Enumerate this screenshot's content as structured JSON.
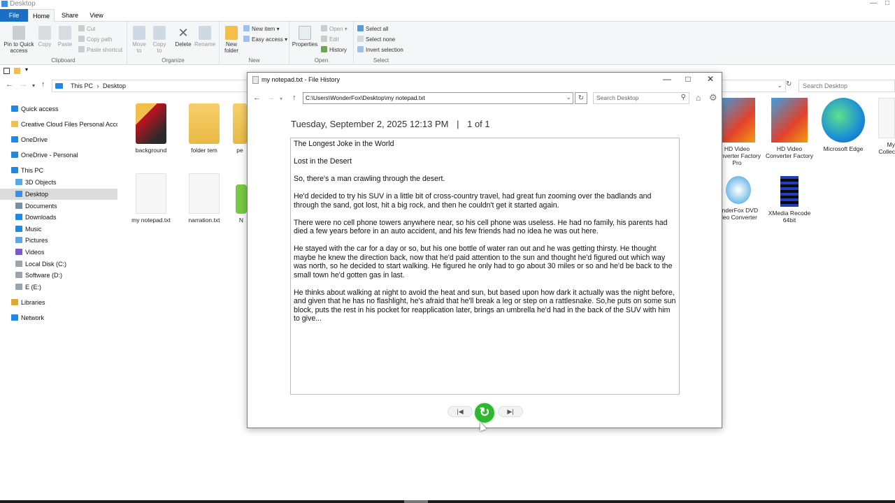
{
  "explorer": {
    "title": "Desktop",
    "tabs": [
      "File",
      "Home",
      "Share",
      "View"
    ],
    "ribbon": {
      "clipboard": {
        "label": "Clipboard",
        "pin": "Pin to Quick access",
        "copy": "Copy",
        "paste": "Paste",
        "cut": "Cut",
        "copy_path": "Copy path",
        "paste_shortcut": "Paste shortcut"
      },
      "organize": {
        "label": "Organize",
        "move_to": "Move to",
        "copy_to": "Copy to",
        "delete": "Delete",
        "rename": "Rename"
      },
      "new": {
        "label": "New",
        "new_folder": "New folder",
        "new_item": "New item",
        "easy_access": "Easy access"
      },
      "open": {
        "label": "Open",
        "properties": "Properties",
        "open": "Open",
        "edit": "Edit",
        "history": "History"
      },
      "select": {
        "label": "Select",
        "select_all": "Select all",
        "select_none": "Select none",
        "invert": "Invert selection"
      }
    },
    "breadcrumb": [
      "This PC",
      "Desktop"
    ],
    "search_placeholder": "Search Desktop",
    "nav": [
      {
        "label": "Quick access",
        "color": "#1e88e5"
      },
      {
        "label": "Creative Cloud Files Personal Account",
        "color": "#f2c04a"
      },
      {
        "label": "OneDrive",
        "color": "#1e88e5"
      },
      {
        "label": "OneDrive - Personal",
        "color": "#1e88e5"
      },
      {
        "label": "This PC",
        "color": "#1e88e5"
      },
      {
        "label": "3D Objects",
        "color": "#5aa9e6"
      },
      {
        "label": "Desktop",
        "color": "#3a8ee6"
      },
      {
        "label": "Documents",
        "color": "#7a8fa6"
      },
      {
        "label": "Downloads",
        "color": "#1e88e5"
      },
      {
        "label": "Music",
        "color": "#1e88e5"
      },
      {
        "label": "Pictures",
        "color": "#5aa9e6"
      },
      {
        "label": "Videos",
        "color": "#7a5ac8"
      },
      {
        "label": "Local Disk (C:)",
        "color": "#9aa4ad"
      },
      {
        "label": "Software (D:)",
        "color": "#9aa4ad"
      },
      {
        "label": "E (E:)",
        "color": "#9aa4ad"
      },
      {
        "label": "Libraries",
        "color": "#e0a830"
      },
      {
        "label": "Network",
        "color": "#1e88e5"
      }
    ],
    "files": [
      {
        "name": "background",
        "kind": "image"
      },
      {
        "name": "folder tem",
        "kind": "folder"
      },
      {
        "name": "pe",
        "kind": "folder"
      },
      {
        "name": "my notepad.txt",
        "kind": "text"
      },
      {
        "name": "narration.txt",
        "kind": "text"
      },
      {
        "name": "N",
        "kind": "app"
      },
      {
        "name": "HD Video Converter Factory Pro",
        "kind": "app"
      },
      {
        "name": "HD Video Converter Factory",
        "kind": "app"
      },
      {
        "name": "Microsoft Edge",
        "kind": "app"
      },
      {
        "name": "My Collec",
        "kind": "app"
      },
      {
        "name": "onderFox DVD deo Converter",
        "kind": "app"
      },
      {
        "name": "XMedia Recode 64bit",
        "kind": "app"
      }
    ]
  },
  "file_history": {
    "title": "my notepad.txt - File History",
    "address": "C:\\Users\\WonderFox\\Desktop\\my notepad.txt",
    "search_placeholder": "Search Desktop",
    "date": "Tuesday, September 2, 2025 12:13 PM",
    "separator": "|",
    "position": "1 of 1",
    "document": [
      "The Longest Joke   in the World",
      "Lost in the Desert",
      "So, there's a man crawling through the desert.",
      "He'd decided to try his SUV in a little bit of cross-country travel, had great fun zooming over the badlands and through the sand, got lost, hit a big rock, and then he couldn't get it started again.",
      "There were no cell phone towers anywhere near, so his cell phone was useless. He had no family, his parents had died a few years before in an auto accident, and his few friends had no idea he was out here.",
      "He stayed with the car for a day or so, but his one bottle of water ran out and he was getting thirsty. He thought maybe he knew the direction back, now that he'd paid attention to the sun and thought he'd figured out which way was north, so he decided to start walking. He figured he only had to go about 30 miles or so and he'd be back to the small town he'd gotten gas in last.",
      "He thinks about walking at night to avoid the heat and sun, but based upon how dark it actually was the night before, and given that he has no flashlight, he's afraid that he'll break a leg or step on a rattlesnake. So,he puts on some sun block, puts the rest in his pocket for reapplication later, brings an umbrella he'd had in the back of the SUV with him to give..."
    ],
    "accent": "#2eb82e"
  }
}
